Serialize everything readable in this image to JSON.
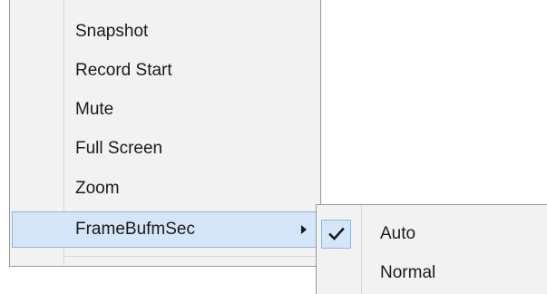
{
  "context_menu": {
    "items": [
      {
        "label": "Snapshot"
      },
      {
        "label": "Record Start"
      },
      {
        "label": "Mute"
      },
      {
        "label": "Full Screen"
      },
      {
        "label": "Zoom"
      },
      {
        "label": "FrameBufmSec",
        "has_submenu": true,
        "highlighted": true
      }
    ]
  },
  "submenu": {
    "items": [
      {
        "label": "Auto",
        "checked": true
      },
      {
        "label": "Normal",
        "checked": false
      }
    ]
  },
  "colors": {
    "menu_background": "#f2f2f2",
    "highlight_fill": "#d5e6f8",
    "highlight_border": "#8db4e3",
    "menu_border": "#979797",
    "text": "#1a1a1a"
  },
  "icons": {
    "submenu_arrow": "triangle-right-icon",
    "check": "checkmark-icon"
  }
}
